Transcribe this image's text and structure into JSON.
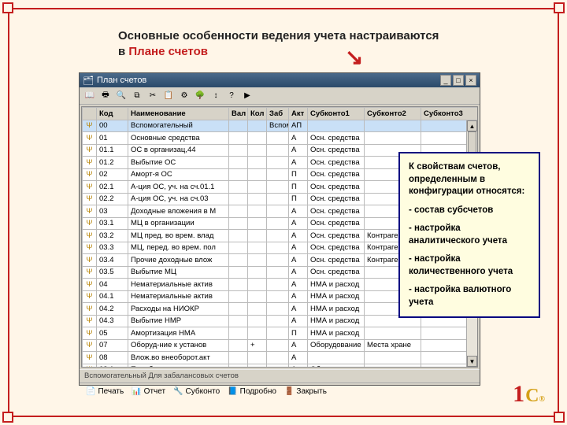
{
  "heading": {
    "p1": "Основные особенности ведения учета настраиваются в ",
    "hl": "Плане счетов"
  },
  "window": {
    "title": "План счетов",
    "info": "Вспомогательный   Для забалансовых счетов",
    "toolbar_icons": [
      "book",
      "print",
      "find",
      "copy",
      "cut",
      "paste",
      "props",
      "tree",
      "sort",
      "help",
      "play"
    ],
    "columns": [
      "",
      "Код",
      "Наименование",
      "Вал",
      "Кол",
      "Заб",
      "Акт",
      "Субконто1",
      "Субконто2",
      "Субконто3"
    ],
    "rows": [
      {
        "k": "00",
        "n": "Вспомогательный",
        "v": "",
        "q": "",
        "z": "Вспом-ый учет",
        "a": "АП",
        "s1": "",
        "s2": "",
        "s3": "",
        "sel": true
      },
      {
        "k": "01",
        "n": "Основные средства",
        "v": "",
        "q": "",
        "z": "",
        "a": "А",
        "s1": "Осн. средства",
        "s2": "",
        "s3": ""
      },
      {
        "k": "01.1",
        "n": "ОС в организац,44",
        "v": "",
        "q": "",
        "z": "",
        "a": "А",
        "s1": "Осн. средства",
        "s2": "",
        "s3": ""
      },
      {
        "k": "01.2",
        "n": "Выбытие ОС",
        "v": "",
        "q": "",
        "z": "",
        "a": "А",
        "s1": "Осн. средства",
        "s2": "",
        "s3": ""
      },
      {
        "k": "02",
        "n": "Аморт-я ОС",
        "v": "",
        "q": "",
        "z": "",
        "a": "П",
        "s1": "Осн. средства",
        "s2": "",
        "s3": ""
      },
      {
        "k": "02.1",
        "n": "А-ция ОС, уч. на сч.01.1",
        "v": "",
        "q": "",
        "z": "",
        "a": "П",
        "s1": "Осн. средства",
        "s2": "",
        "s3": ""
      },
      {
        "k": "02.2",
        "n": "А-ция ОС, уч. на сч.03",
        "v": "",
        "q": "",
        "z": "",
        "a": "П",
        "s1": "Осн. средства",
        "s2": "",
        "s3": ""
      },
      {
        "k": "03",
        "n": "Доходные вложения в М",
        "v": "",
        "q": "",
        "z": "",
        "a": "А",
        "s1": "Осн. средства",
        "s2": "",
        "s3": ""
      },
      {
        "k": "03.1",
        "n": "МЦ в организации",
        "v": "",
        "q": "",
        "z": "",
        "a": "А",
        "s1": "Осн. средства",
        "s2": "",
        "s3": ""
      },
      {
        "k": "03.2",
        "n": "МЦ пред. во врем. влад",
        "v": "",
        "q": "",
        "z": "",
        "a": "А",
        "s1": "Осн. средства",
        "s2": "Контрагенты",
        "s3": ""
      },
      {
        "k": "03.3",
        "n": "МЦ, перед. во врем. пол",
        "v": "",
        "q": "",
        "z": "",
        "a": "А",
        "s1": "Осн. средства",
        "s2": "Контрагенты",
        "s3": ""
      },
      {
        "k": "03.4",
        "n": "Прочие доходные влож",
        "v": "",
        "q": "",
        "z": "",
        "a": "А",
        "s1": "Осн. средства",
        "s2": "Контрагенты",
        "s3": ""
      },
      {
        "k": "03.5",
        "n": "Выбытие МЦ",
        "v": "",
        "q": "",
        "z": "",
        "a": "А",
        "s1": "Осн. средства",
        "s2": "",
        "s3": ""
      },
      {
        "k": "04",
        "n": "Нематериальные актив",
        "v": "",
        "q": "",
        "z": "",
        "a": "А",
        "s1": "НМА и расход",
        "s2": "",
        "s3": ""
      },
      {
        "k": "04.1",
        "n": "Нематериальные актив",
        "v": "",
        "q": "",
        "z": "",
        "a": "А",
        "s1": "НМА и расход",
        "s2": "",
        "s3": ""
      },
      {
        "k": "04.2",
        "n": "Расходы на НИОКР",
        "v": "",
        "q": "",
        "z": "",
        "a": "А",
        "s1": "НМА и расход",
        "s2": "",
        "s3": ""
      },
      {
        "k": "04.3",
        "n": "Выбытие НМР",
        "v": "",
        "q": "",
        "z": "",
        "a": "А",
        "s1": "НМА и расход",
        "s2": "",
        "s3": ""
      },
      {
        "k": "05",
        "n": "Амортизация НМА",
        "v": "",
        "q": "",
        "z": "",
        "a": "П",
        "s1": "НМА и расход",
        "s2": "",
        "s3": ""
      },
      {
        "k": "07",
        "n": "Оборуд-ние к установ",
        "v": "",
        "q": "+",
        "z": "",
        "a": "А",
        "s1": "Оборудование",
        "s2": "Места хране",
        "s3": ""
      },
      {
        "k": "08",
        "n": "Влож.во внеоборот.акт",
        "v": "",
        "q": "",
        "z": "",
        "a": "А",
        "s1": "",
        "s2": "",
        "s3": ""
      },
      {
        "k": "08.1",
        "n": "Приобретение зем.уча",
        "v": "",
        "q": "",
        "z": "",
        "a": "А",
        "s1": "Объекты внео",
        "s2": "",
        "s3": ""
      }
    ],
    "buttons": {
      "print": "Печать",
      "report": "Отчет",
      "subk": "Субконто",
      "more": "Подробно",
      "close": "Закрыть"
    }
  },
  "callout": {
    "l1": "К свойствам счетов, определенным в конфигурации относятся:",
    "l2": " - состав субсчетов",
    "l3": " - настройка аналитического  учета",
    "l4": " - настройка количественного учета",
    "l5": " - настройка валютного учета"
  },
  "logo": {
    "one": "1",
    "c": "С"
  }
}
